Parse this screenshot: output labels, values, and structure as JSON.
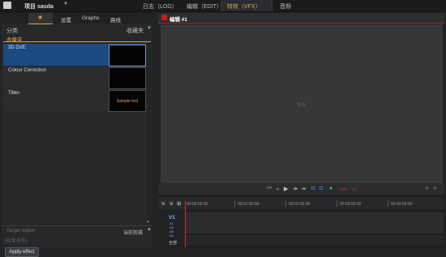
{
  "app": {
    "project_label": "项目 sasda",
    "modes": [
      {
        "label": "日志（LOG）"
      },
      {
        "label": "编辑（EDIT）"
      },
      {
        "label": "特效（VFX）"
      },
      {
        "label": "音频"
      }
    ]
  },
  "left_panel": {
    "tabs": [
      {
        "label": "★"
      },
      {
        "label": "设置"
      },
      {
        "label": "Graphs"
      },
      {
        "label": "路线"
      }
    ],
    "category_label": "分类",
    "favorites_dropdown": "收藏夹",
    "favorites_heading": "收藏夹",
    "effects": [
      {
        "name": "3D DVE",
        "thumb_text": ""
      },
      {
        "name": "Colour Correction",
        "thumb_text": ""
      },
      {
        "name": "Titles",
        "thumb_text": "Sample text"
      }
    ],
    "target_region_label": "Target region",
    "target_dropdown": "当前剪辑",
    "effect_field_placeholder": "[效果名称]",
    "apply_button": "Apply effect"
  },
  "viewer": {
    "title": "编辑 #1",
    "center_text": "无标"
  },
  "transport": {
    "icons": [
      "skip-start-icon",
      "step-back-icon",
      "play-icon",
      "step-forward-icon",
      "skip-end-icon",
      "mark-in-icon",
      "mark-out-icon",
      "record-icon",
      "safe-area-icon",
      "fullscreen-icon",
      "undo-icon",
      "redo-icon"
    ]
  },
  "timeline": {
    "timecodes": [
      "00:00:00:00",
      "00:01:00:00",
      "00:02:00:00",
      "00:03:00:00",
      "00:04:00:00"
    ],
    "track_v1": "V1",
    "track_small": [
      "A1",
      "A2",
      "A3",
      "A4"
    ],
    "track_bottom": "全部"
  }
}
